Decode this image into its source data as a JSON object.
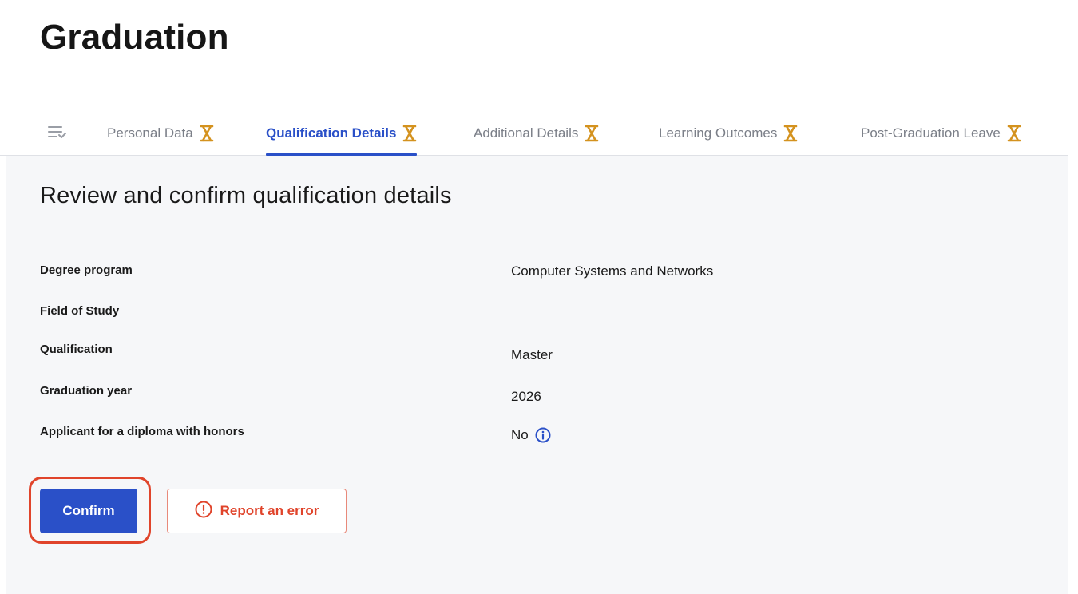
{
  "page": {
    "title": "Graduation"
  },
  "tabs": [
    {
      "label": "Personal Data",
      "status_icon": "hourglass-icon",
      "active": false
    },
    {
      "label": "Qualification Details",
      "status_icon": "hourglass-icon",
      "active": true
    },
    {
      "label": "Additional Details",
      "status_icon": "hourglass-icon",
      "active": false
    },
    {
      "label": "Learning Outcomes",
      "status_icon": "hourglass-icon",
      "active": false
    },
    {
      "label": "Post-Graduation Leave",
      "status_icon": "hourglass-icon",
      "active": false
    }
  ],
  "menu_icon": "checklist-menu-icon",
  "section": {
    "title": "Review and confirm qualification details",
    "rows": [
      {
        "label": "Degree program",
        "value": "Computer Systems and Networks"
      },
      {
        "label": "Field of Study",
        "value": ""
      },
      {
        "label": "Qualification",
        "value": "Master"
      },
      {
        "label": "Graduation year",
        "value": "2026"
      },
      {
        "label": "Applicant for a diploma with honors",
        "value": "No",
        "icon": "info-icon"
      }
    ]
  },
  "actions": {
    "confirm_label": "Confirm",
    "report_label": "Report an error",
    "report_icon": "alert-circle-icon"
  },
  "colors": {
    "accent": "#2a50c8",
    "danger": "#e0442b",
    "pending": "#d4921e",
    "muted_text": "#7b7f88",
    "content_bg": "#f6f7f9"
  }
}
